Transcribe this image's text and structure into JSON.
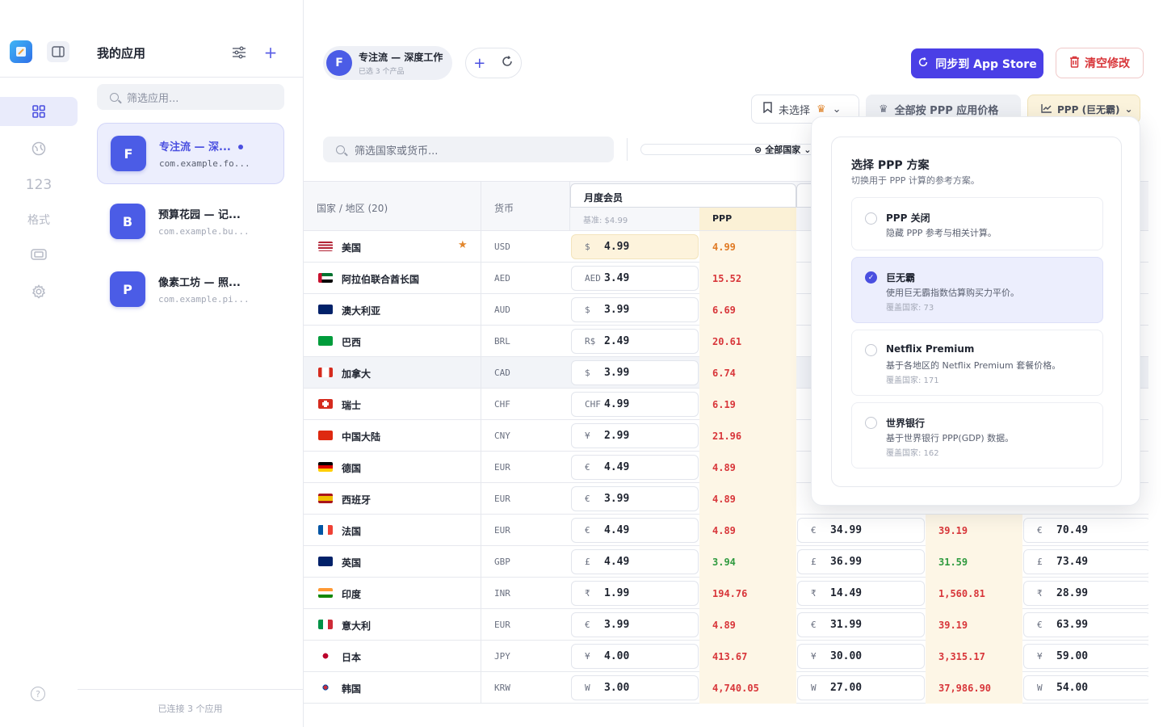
{
  "rail": {
    "nav_label_numbers": "123",
    "nav_label_format": "格式"
  },
  "sidebar": {
    "title": "我的应用",
    "search_placeholder": "筛选应用...",
    "apps": [
      {
        "letter": "F",
        "name": "专注流 — 深...",
        "bundle": "com.example.fo..."
      },
      {
        "letter": "B",
        "name": "预算花园 — 记...",
        "bundle": "com.example.bu..."
      },
      {
        "letter": "P",
        "name": "像素工坊 — 照...",
        "bundle": "com.example.pi..."
      }
    ],
    "footer": "已连接 3 个应用"
  },
  "header": {
    "app_letter": "F",
    "app_name": "专注流 — 深度工作",
    "app_sub": "已选 3 个产品",
    "sync_label": "同步到 App Store",
    "clear_label": "清空修改",
    "bookmark_label": "未选择",
    "apply_all_label": "全部按 PPP 应用价格",
    "ppp_label": "PPP (巨无霸)",
    "country_search_placeholder": "筛选国家或货币...",
    "country_filter_label": "全部国家"
  },
  "table": {
    "col_country": "国家 / 地区 (20)",
    "col_currency": "货币",
    "tier_name": "月度会员",
    "base_label": "基准: $4.99",
    "ppp_col": "PPP",
    "rows": [
      {
        "country": "美国",
        "code": "USD",
        "sym": "$",
        "price": "4.99",
        "ppp": "4.99",
        "ppp_color": "orange",
        "star": true,
        "flag": "us"
      },
      {
        "country": "阿拉伯联合酋长国",
        "code": "AED",
        "sym": "AED",
        "price": "3.49",
        "ppp": "15.52",
        "ppp_color": "red",
        "flag": "ae"
      },
      {
        "country": "澳大利亚",
        "code": "AUD",
        "sym": "$",
        "price": "3.99",
        "ppp": "6.69",
        "ppp_color": "red",
        "flag": "au"
      },
      {
        "country": "巴西",
        "code": "BRL",
        "sym": "R$",
        "price": "2.49",
        "ppp": "20.61",
        "ppp_color": "red",
        "flag": "br"
      },
      {
        "country": "加拿大",
        "code": "CAD",
        "sym": "$",
        "price": "3.99",
        "ppp": "6.74",
        "ppp_color": "red",
        "flag": "ca",
        "highlight": true
      },
      {
        "country": "瑞士",
        "code": "CHF",
        "sym": "CHF",
        "price": "4.99",
        "ppp": "6.19",
        "ppp_color": "red",
        "flag": "ch"
      },
      {
        "country": "中国大陆",
        "code": "CNY",
        "sym": "¥",
        "price": "2.99",
        "ppp": "21.96",
        "ppp_color": "red",
        "flag": "cn"
      },
      {
        "country": "德国",
        "code": "EUR",
        "sym": "€",
        "price": "4.49",
        "ppp": "4.89",
        "ppp_color": "red",
        "flag": "de"
      },
      {
        "country": "西班牙",
        "code": "EUR",
        "sym": "€",
        "price": "3.99",
        "ppp": "4.89",
        "ppp_color": "red",
        "flag": "es"
      },
      {
        "country": "法国",
        "code": "EUR",
        "sym": "€",
        "price": "4.49",
        "ppp": "4.89",
        "ppp_color": "red",
        "flag": "fr",
        "price2": "34.99",
        "ppp2": "39.19",
        "ppp2_color": "red",
        "price3": "70.49"
      },
      {
        "country": "英国",
        "code": "GBP",
        "sym": "£",
        "price": "4.49",
        "ppp": "3.94",
        "ppp_color": "green",
        "flag": "gb",
        "price2": "36.99",
        "ppp2": "31.59",
        "ppp2_color": "green",
        "price3": "73.49"
      },
      {
        "country": "印度",
        "code": "INR",
        "sym": "₹",
        "price": "1.99",
        "ppp": "194.76",
        "ppp_color": "red",
        "flag": "in",
        "price2": "14.49",
        "ppp2": "1,560.81",
        "ppp2_color": "red",
        "price3": "28.99"
      },
      {
        "country": "意大利",
        "code": "EUR",
        "sym": "€",
        "price": "3.99",
        "ppp": "4.89",
        "ppp_color": "red",
        "flag": "it",
        "price2": "31.99",
        "ppp2": "39.19",
        "ppp2_color": "red",
        "price3": "63.99"
      },
      {
        "country": "日本",
        "code": "JPY",
        "sym": "¥",
        "price": "4.00",
        "ppp": "413.67",
        "ppp_color": "red",
        "flag": "jp",
        "price2": "30.00",
        "ppp2": "3,315.17",
        "ppp2_color": "red",
        "price3": "59.00"
      },
      {
        "country": "韩国",
        "code": "KRW",
        "sym": "W",
        "price": "3.00",
        "ppp": "4,740.05",
        "ppp_color": "red",
        "flag": "kr",
        "price2": "27.00",
        "ppp2": "37,986.90",
        "ppp2_color": "red",
        "price3": "54.00"
      }
    ]
  },
  "popover": {
    "title": "选择 PPP 方案",
    "subtitle": "切换用于 PPP 计算的参考方案。",
    "options": [
      {
        "name": "PPP 关闭",
        "desc": "隐藏 PPP 参考与相关计算。",
        "count": "",
        "selected": false
      },
      {
        "name": "巨无霸",
        "desc": "使用巨无霸指数估算购买力平价。",
        "count": "覆盖国家: 73",
        "selected": true
      },
      {
        "name": "Netflix Premium",
        "desc": "基于各地区的 Netflix Premium 套餐价格。",
        "count": "覆盖国家: 171",
        "selected": false
      },
      {
        "name": "世界银行",
        "desc": "基于世界银行 PPP(GDP) 数据。",
        "count": "覆盖国家: 162",
        "selected": false
      }
    ]
  },
  "colors": {
    "accent": "#4a4fe0",
    "danger": "#d8363a",
    "ppp_highlight": "#fdf6e6"
  }
}
